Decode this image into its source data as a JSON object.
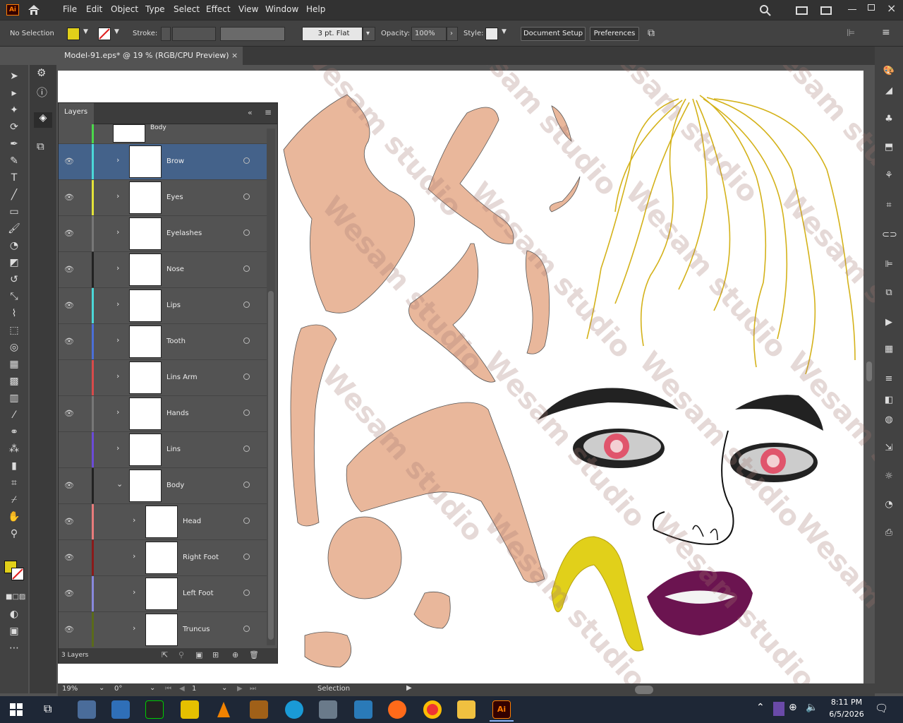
{
  "app": {
    "logo": "Ai",
    "home_icon": "home-icon"
  },
  "menu": [
    "File",
    "Edit",
    "Object",
    "Type",
    "Select",
    "Effect",
    "View",
    "Window",
    "Help"
  ],
  "control": {
    "selection_status": "No Selection",
    "fill_color": "#e1d01a",
    "stroke_label": "Stroke:",
    "brush_label": "3 pt. Flat",
    "opacity_label": "Opacity:",
    "opacity_value": "100%",
    "style_label": "Style:",
    "document_setup": "Document Setup",
    "preferences": "Preferences"
  },
  "document": {
    "tab_title": "Model-91.eps* @ 19 % (RGB/CPU Preview)",
    "close": "×"
  },
  "layers_panel": {
    "title": "Layers",
    "count_label": "3 Layers",
    "top_partial": "Body",
    "rows": [
      {
        "name": "Brow",
        "visible": true,
        "color": "#4bd8d8",
        "selected": true
      },
      {
        "name": "Eyes",
        "visible": true,
        "color": "#e3e33a"
      },
      {
        "name": "Eyelashes",
        "visible": true,
        "color": "#777777"
      },
      {
        "name": "Nose",
        "visible": true,
        "color": "#222222"
      },
      {
        "name": "Lips",
        "visible": true,
        "color": "#4bd8d8"
      },
      {
        "name": "Tooth",
        "visible": true,
        "color": "#4b6fd8"
      },
      {
        "name": "Lins Arm",
        "visible": false,
        "color": "#d84b4b"
      },
      {
        "name": "Hands",
        "visible": true,
        "color": "#777777"
      },
      {
        "name": "Lins",
        "visible": false,
        "color": "#6b4bd8"
      },
      {
        "name": "Body",
        "visible": true,
        "color": "#222222",
        "expanded": true
      },
      {
        "name": "Head",
        "visible": true,
        "color": "#e87b7b",
        "child": true
      },
      {
        "name": "Right Foot",
        "visible": true,
        "color": "#8a1a1a",
        "child": true
      },
      {
        "name": "Left Foot",
        "visible": true,
        "color": "#8888dd",
        "child": true
      },
      {
        "name": "Truncus",
        "visible": true,
        "color": "#5a6a1a",
        "child": true
      }
    ]
  },
  "status": {
    "zoom": "19%",
    "rotation": "0°",
    "artboard": "1",
    "tool": "Selection"
  },
  "taskbar": {
    "time": "8:11 PM",
    "date": "6/5/2026"
  },
  "watermark": "Wesam studio",
  "colors": {
    "skin": "#e9b79b",
    "hair": "#d4b21a",
    "lips": "#6b1450",
    "iris": "#e0556c"
  }
}
